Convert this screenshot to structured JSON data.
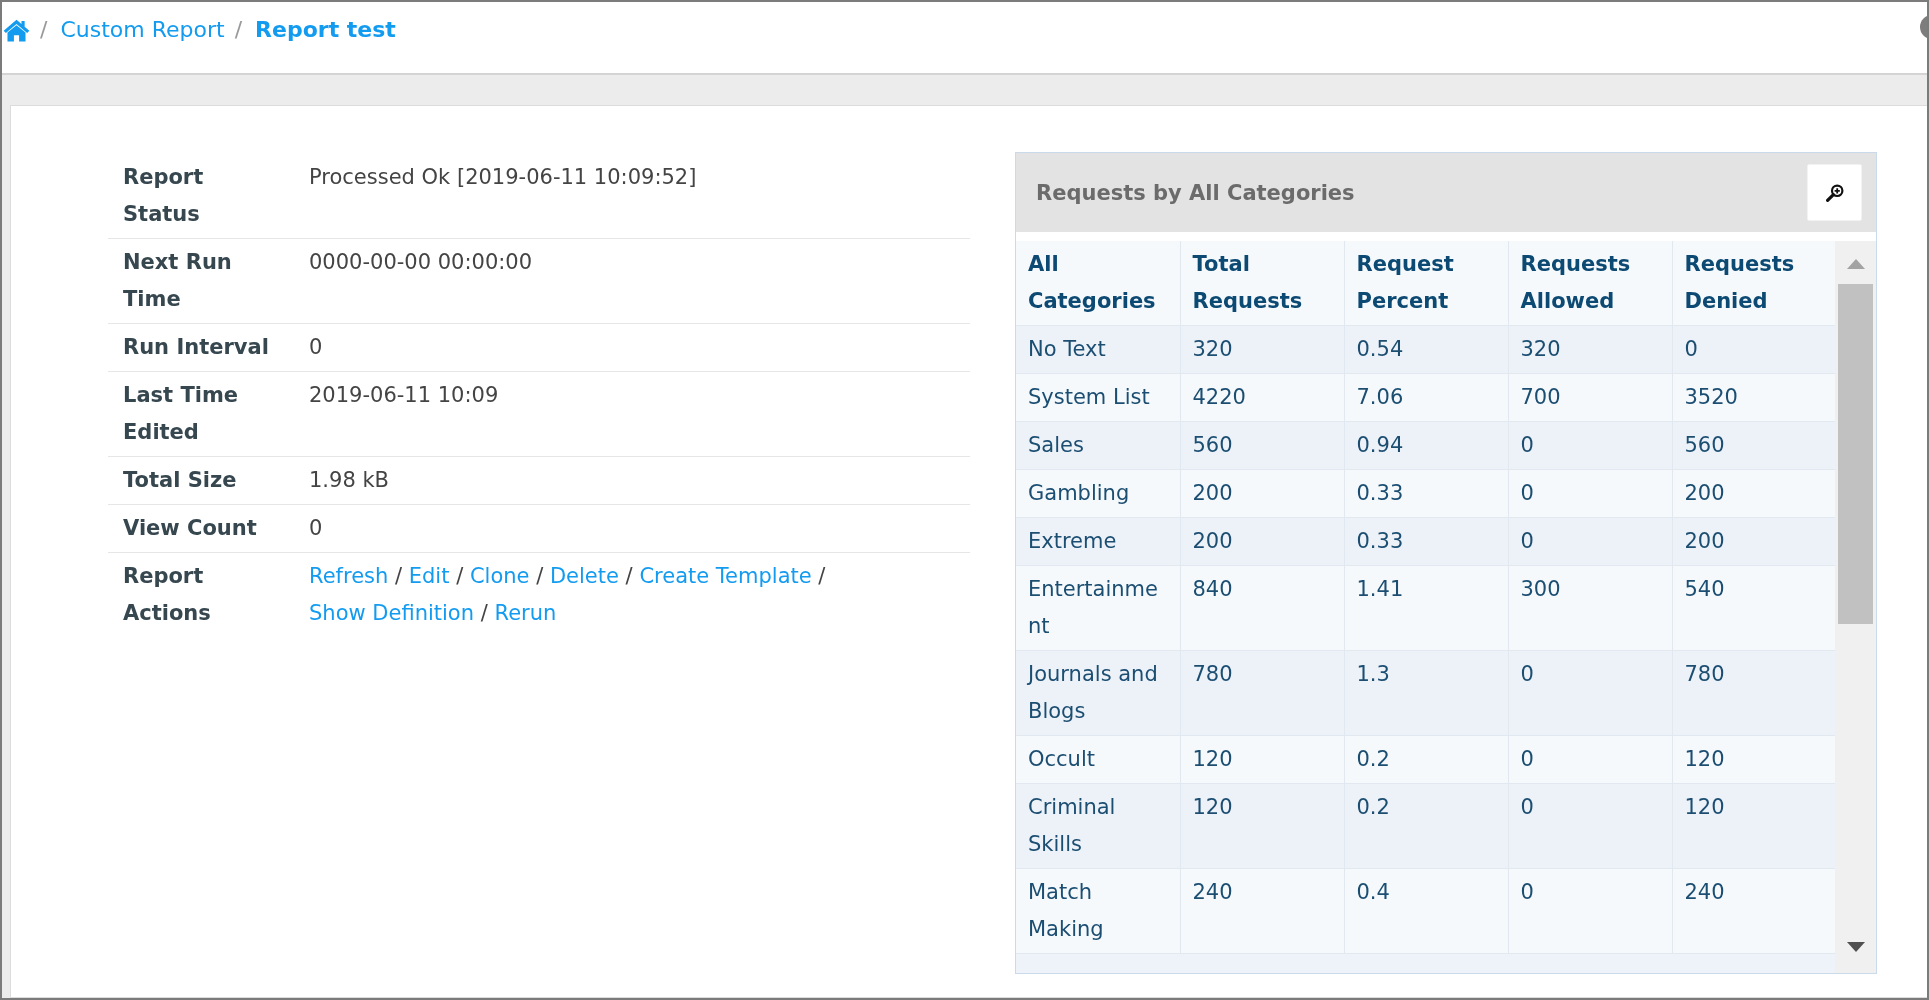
{
  "breadcrumb": {
    "separator": "/",
    "items": [
      {
        "label": "Custom Report",
        "kind": "link"
      },
      {
        "label": "Report test",
        "kind": "current"
      }
    ]
  },
  "details": [
    {
      "label": "Report Status",
      "kind": "text",
      "value": "Processed Ok [2019-06-11 10:09:52]"
    },
    {
      "label": "Next Run Time",
      "kind": "text",
      "value": "0000-00-00 00:00:00"
    },
    {
      "label": "Run Interval",
      "kind": "text",
      "value": "0"
    },
    {
      "label": "Last Time Edited",
      "kind": "text",
      "value": "2019-06-11 10:09"
    },
    {
      "label": "Total Size",
      "kind": "text",
      "value": "1.98 kB"
    },
    {
      "label": "View Count",
      "kind": "text",
      "value": "0"
    },
    {
      "label": "Report Actions",
      "kind": "actions",
      "separator": "/",
      "actions": [
        "Refresh",
        "Edit",
        "Clone",
        "Delete",
        "Create Template",
        "Show Definition",
        "Rerun"
      ]
    }
  ],
  "panel": {
    "title": "Requests by All Categories",
    "table": {
      "columns": [
        "All Categories",
        "Total Requests",
        "Request Percent",
        "Requests Allowed",
        "Requests Denied"
      ],
      "rows": [
        [
          "No Text",
          "320",
          "0.54",
          "320",
          "0"
        ],
        [
          "System List",
          "4220",
          "7.06",
          "700",
          "3520"
        ],
        [
          "Sales",
          "560",
          "0.94",
          "0",
          "560"
        ],
        [
          "Gambling",
          "200",
          "0.33",
          "0",
          "200"
        ],
        [
          "Extreme",
          "200",
          "0.33",
          "0",
          "200"
        ],
        [
          "Entertainment",
          "840",
          "1.41",
          "300",
          "540"
        ],
        [
          "Journals and Blogs",
          "780",
          "1.3",
          "0",
          "780"
        ],
        [
          "Occult",
          "120",
          "0.2",
          "0",
          "120"
        ],
        [
          "Criminal Skills",
          "120",
          "0.2",
          "0",
          "120"
        ],
        [
          "Match Making",
          "240",
          "0.4",
          "0",
          "240"
        ]
      ]
    }
  }
}
